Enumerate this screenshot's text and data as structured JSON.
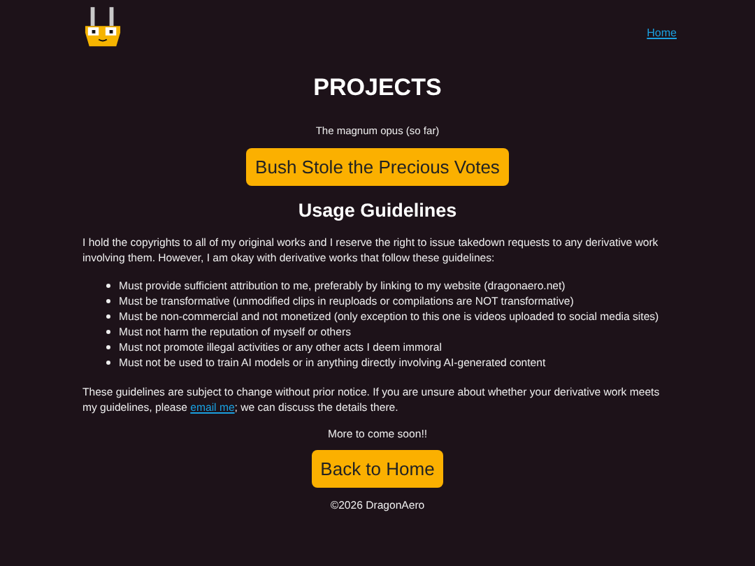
{
  "nav": {
    "home_link": "Home"
  },
  "title": "PROJECTS",
  "subtitle": "The magnum opus (so far)",
  "project_button": "Bush Stole the Precious Votes",
  "guidelines": {
    "heading": "Usage Guidelines",
    "intro": "I hold the copyrights to all of my original works and I reserve the right to issue takedown requests to any derivative work involving them. However, I am okay with derivative works that follow these guidelines:",
    "items": [
      "Must provide sufficient attribution to me, preferably by linking to my website (dragonaero.net)",
      "Must be transformative (unmodified clips in reuploads or compilations are NOT transformative)",
      "Must be non-commercial and not monetized (only exception to this one is videos uploaded to social media sites)",
      "Must not harm the reputation of myself or others",
      "Must not promote illegal activities or any other acts I deem immoral",
      "Must not be used to train AI models or in anything directly involving AI-generated content"
    ],
    "closing": {
      "before": "These guidelines are subject to change without prior notice. If you are unsure about whether your derivative work meets my guidelines, please ",
      "link": "email me",
      "after": "; we can discuss the details there."
    }
  },
  "more": "More to come soon!!",
  "back_button": "Back to Home",
  "footer": "©2026 DragonAero"
}
